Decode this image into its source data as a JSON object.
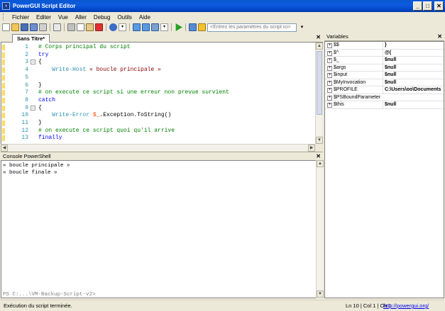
{
  "window": {
    "title": "PowerGUI Script Editor",
    "icon": "powershell-icon"
  },
  "window_buttons": {
    "minimize": "_",
    "maximize": "□",
    "close": "✕"
  },
  "menu": [
    "Fichier",
    "Editer",
    "Vue",
    "Aller",
    "Debug",
    "Outils",
    "Aide"
  ],
  "toolbar": {
    "params_placeholder": "<Entrez les paramètres du script ici>"
  },
  "editor": {
    "tab_label": "Sans Titre*",
    "close_label": "✕",
    "lines": [
      {
        "n": "1",
        "parts": [
          [
            "c-comment",
            "# Corps principal du script"
          ]
        ]
      },
      {
        "n": "2",
        "parts": [
          [
            "c-keyword",
            "try"
          ]
        ]
      },
      {
        "n": "3",
        "parts": [
          [
            "c-plain",
            "{"
          ]
        ]
      },
      {
        "n": "4",
        "parts": [
          [
            "c-cmdlet",
            "    Write-Host "
          ],
          [
            "c-string",
            "« boucle principale »"
          ]
        ]
      },
      {
        "n": "5",
        "parts": [
          [
            "c-plain",
            ""
          ]
        ]
      },
      {
        "n": "6",
        "parts": [
          [
            "c-plain",
            "}"
          ]
        ]
      },
      {
        "n": "7",
        "parts": [
          [
            "c-comment",
            "# on execute ce script si une erreur non prevue survient"
          ]
        ]
      },
      {
        "n": "8",
        "parts": [
          [
            "c-keyword",
            "catch"
          ]
        ]
      },
      {
        "n": "9",
        "parts": [
          [
            "c-plain",
            "{"
          ]
        ]
      },
      {
        "n": "10",
        "parts": [
          [
            "c-cmdlet",
            "    Write-Error "
          ],
          [
            "c-var",
            "$_"
          ],
          [
            "c-plain",
            ".Exception.ToString()"
          ]
        ]
      },
      {
        "n": "11",
        "parts": [
          [
            "c-plain",
            "}"
          ]
        ]
      },
      {
        "n": "12",
        "parts": [
          [
            "c-comment",
            "# on execute ce script quoi qu'il arrive"
          ]
        ]
      },
      {
        "n": "13",
        "parts": [
          [
            "c-keyword",
            "finally"
          ]
        ]
      }
    ]
  },
  "console": {
    "title": "Console PowerShell",
    "close_label": "✕",
    "lines": [
      "« boucle principale »",
      "« boucle finale »"
    ],
    "prompt": "PS C:...\\VM-Backup-Script-v2>"
  },
  "variables": {
    "title": "Variables",
    "close_label": "✕",
    "rows": [
      {
        "name": "$$",
        "value": "}"
      },
      {
        "name": "$^",
        "value": "@("
      },
      {
        "name": "$_",
        "value": "$null"
      },
      {
        "name": "$args",
        "value": "$null"
      },
      {
        "name": "$input",
        "value": "$null"
      },
      {
        "name": "$MyInvocation",
        "value": "$null"
      },
      {
        "name": "$PROFILE",
        "value": "C:\\Users\\oo\\Documents"
      },
      {
        "name": "$PSBoundParameters",
        "value": ""
      },
      {
        "name": "$this",
        "value": "$null"
      }
    ]
  },
  "status": {
    "message": "Exécution du script terminée.",
    "position": "Ln 10 | Col 1 | Ch 1",
    "link": "http://powergui.org/"
  }
}
